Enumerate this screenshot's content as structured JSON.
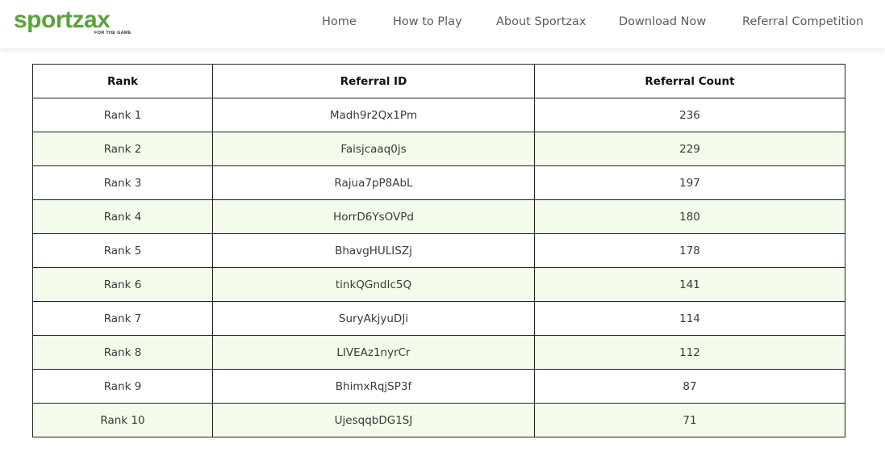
{
  "header": {
    "logo_text": "sportzax",
    "logo_tagline": "FOR THE GAME",
    "brand_color": "#5aa33a",
    "nav": {
      "home": "Home",
      "how_to_play": "How to Play",
      "about": "About Sportzax",
      "download": "Download Now",
      "referral": "Referral Competition"
    }
  },
  "table": {
    "headers": {
      "rank": "Rank",
      "referral_id": "Referral ID",
      "referral_count": "Referral Count"
    },
    "row_alt_color": "#f3fbea",
    "rows": [
      {
        "rank": "Rank 1",
        "id": "Madh9r2Qx1Pm",
        "count": "236"
      },
      {
        "rank": "Rank 2",
        "id": "Faisjcaaq0js",
        "count": "229"
      },
      {
        "rank": "Rank 3",
        "id": "Rajua7pP8AbL",
        "count": "197"
      },
      {
        "rank": "Rank 4",
        "id": "HorrD6YsOVPd",
        "count": "180"
      },
      {
        "rank": "Rank 5",
        "id": "BhavgHULISZj",
        "count": "178"
      },
      {
        "rank": "Rank 6",
        "id": "tinkQGndIc5Q",
        "count": "141"
      },
      {
        "rank": "Rank 7",
        "id": "SuryAkjyuDJi",
        "count": "114"
      },
      {
        "rank": "Rank 8",
        "id": "LIVEAz1nyrCr",
        "count": "112"
      },
      {
        "rank": "Rank 9",
        "id": "BhimxRqjSP3f",
        "count": "87"
      },
      {
        "rank": "Rank 10",
        "id": "UjesqqbDG1SJ",
        "count": "71"
      }
    ]
  }
}
